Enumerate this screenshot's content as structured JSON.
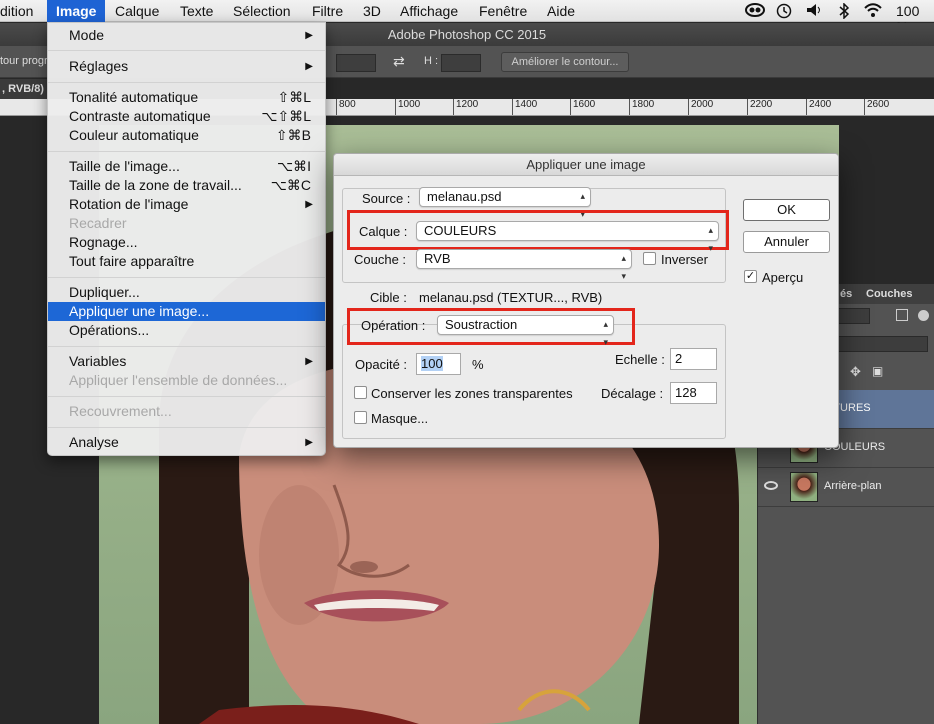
{
  "menubar": {
    "items": [
      "dition",
      "Image",
      "Calque",
      "Texte",
      "Sélection",
      "Filtre",
      "3D",
      "Affichage",
      "Fenêtre",
      "Aide"
    ],
    "battery": "100 %"
  },
  "app_title": "Adobe Photoshop CC 2015",
  "options_bar": {
    "left_text": "tour progr",
    "h_label": "H :",
    "refine_button": "Améliorer le contour..."
  },
  "doc_tab": ", RVB/8)",
  "ruler": [
    "800",
    "1000",
    "1200",
    "1400",
    "1600",
    "1800",
    "2000",
    "2200",
    "2400",
    "2600"
  ],
  "image_menu": {
    "items": [
      {
        "label": "Mode",
        "submenu": true
      },
      {
        "label": "Réglages",
        "submenu": true
      },
      {
        "label": "Tonalité automatique",
        "shortcut": "⇧⌘L"
      },
      {
        "label": "Contraste automatique",
        "shortcut": "⌥⇧⌘L"
      },
      {
        "label": "Couleur automatique",
        "shortcut": "⇧⌘B"
      },
      {
        "label": "Taille de l'image...",
        "shortcut": "⌥⌘I"
      },
      {
        "label": "Taille de la zone de travail...",
        "shortcut": "⌥⌘C"
      },
      {
        "label": "Rotation de l'image",
        "submenu": true
      },
      {
        "label": "Recadrer",
        "disabled": true
      },
      {
        "label": "Rognage..."
      },
      {
        "label": "Tout faire apparaître"
      },
      {
        "label": "Dupliquer..."
      },
      {
        "label": "Appliquer une image...",
        "selected": true
      },
      {
        "label": "Opérations..."
      },
      {
        "label": "Variables",
        "submenu": true
      },
      {
        "label": "Appliquer l'ensemble de données...",
        "disabled": true
      },
      {
        "label": "Recouvrement...",
        "disabled": true
      },
      {
        "label": "Analyse",
        "submenu": true
      }
    ]
  },
  "dialog": {
    "title": "Appliquer une image",
    "source_label": "Source :",
    "source_value": "melanau.psd",
    "layer_label": "Calque :",
    "layer_value": "COULEURS",
    "channel_label": "Couche :",
    "channel_value": "RVB",
    "invert_label": "Inverser",
    "target_label": "Cible :",
    "target_value": "melanau.psd (TEXTUR..., RVB)",
    "operation_label": "Opération :",
    "operation_value": "Soustraction",
    "opacity_label": "Opacité :",
    "opacity_value": "100",
    "opacity_unit": "%",
    "scale_label": "Echelle :",
    "scale_value": "2",
    "offset_label": "Décalage :",
    "offset_value": "128",
    "preserve_label": "Conserver les zones transparentes",
    "mask_label": "Masque...",
    "ok_label": "OK",
    "cancel_label": "Annuler",
    "preview_label": "Aperçu",
    "preview_checked": "✓",
    "highlight_color": "#e3261b"
  },
  "layers_panel": {
    "tabs": [
      "és",
      "Couches"
    ],
    "layers": [
      {
        "name": "XTURES",
        "selected": true
      },
      {
        "name": "COULEURS"
      },
      {
        "name": "Arrière-plan",
        "visible": true
      }
    ]
  }
}
